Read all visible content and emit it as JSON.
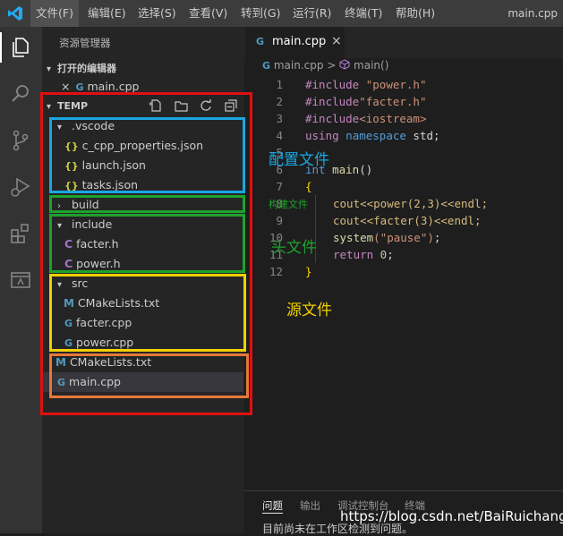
{
  "menubar": {
    "items": [
      "文件(F)",
      "编辑(E)",
      "选择(S)",
      "查看(V)",
      "转到(G)",
      "运行(R)",
      "终端(T)",
      "帮助(H)"
    ],
    "window_title": "main.cpp"
  },
  "activity_bar": {
    "icons": [
      "files-icon",
      "search-icon",
      "source-control-icon",
      "run-debug-icon",
      "extensions-icon",
      "remote-explorer-icon"
    ]
  },
  "sidebar": {
    "title": "资源管理器",
    "open_editors": {
      "label": "打开的编辑器",
      "items": [
        {
          "name": "main.cpp",
          "close": "×"
        }
      ]
    },
    "workspace": {
      "label": "TEMP",
      "tree": [
        {
          "name": ".vscode",
          "type": "folder",
          "expanded": true
        },
        {
          "name": "c_cpp_properties.json",
          "type": "json"
        },
        {
          "name": "launch.json",
          "type": "json"
        },
        {
          "name": "tasks.json",
          "type": "json"
        },
        {
          "name": "build",
          "type": "folder",
          "expanded": false
        },
        {
          "name": "include",
          "type": "folder",
          "expanded": true
        },
        {
          "name": "facter.h",
          "type": "c"
        },
        {
          "name": "power.h",
          "type": "c"
        },
        {
          "name": "src",
          "type": "folder",
          "expanded": true
        },
        {
          "name": "CMakeLists.txt",
          "type": "cmake"
        },
        {
          "name": "facter.cpp",
          "type": "cpp"
        },
        {
          "name": "power.cpp",
          "type": "cpp"
        },
        {
          "name": "CMakeLists.txt",
          "type": "cmake"
        },
        {
          "name": "main.cpp",
          "type": "cpp",
          "selected": true
        }
      ]
    }
  },
  "editor": {
    "tab": {
      "label": "main.cpp",
      "close": "×"
    },
    "breadcrumb": {
      "file": "main.cpp",
      "separator": ">",
      "symbol": "main()"
    },
    "line_numbers": [
      "1",
      "2",
      "3",
      "4",
      "5",
      "6",
      "7",
      "8",
      "9",
      "10",
      "11",
      "12"
    ],
    "code": {
      "l1": {
        "dir": "#include",
        "str": " \"power.h\""
      },
      "l2": {
        "dir": "#include",
        "str": "\"facter.h\""
      },
      "l3": {
        "dir": "#include",
        "str": "<iostream>"
      },
      "l4": {
        "kw1": "using",
        "kw2": " namespace",
        "plain": " std;"
      },
      "l6": {
        "kw": "int",
        "fn": " main",
        "plain": "()"
      },
      "l7": {
        "br": "{"
      },
      "l8": "cout<<power(2,3)<<endl;",
      "l9": "cout<<facter(3)<<endl;",
      "l10": {
        "fn": "system",
        "str": "(\"pause\")",
        "plain": ";"
      },
      "l11": {
        "kw": "return",
        "num": " 0",
        "plain": ";"
      },
      "l12": {
        "br": "}"
      }
    }
  },
  "panel": {
    "tabs": [
      "问题",
      "输出",
      "调试控制台",
      "终端"
    ],
    "message": "目前尚未在工作区检测到问题。"
  },
  "annotations": {
    "config": "配置文件",
    "build": "构建文件",
    "header": "头文件",
    "source": "源文件",
    "colors": {
      "red": "#e01010",
      "blue": "#1aa7e0",
      "green": "#1ea22c",
      "yellow": "#f0d000",
      "orange": "#e8783a"
    }
  },
  "watermark": "https://blog.csdn.net/BaiRuichang"
}
